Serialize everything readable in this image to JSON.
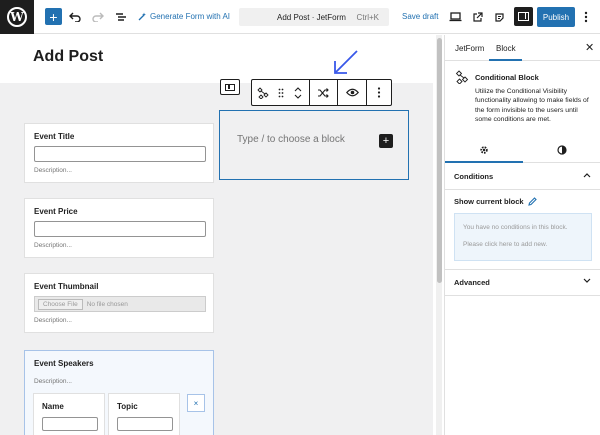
{
  "topbar": {
    "generate_ai_label": "Generate Form with AI",
    "doc_title": "Add Post · JetForm",
    "shortcut": "Ctrl+K",
    "save_draft": "Save draft",
    "publish": "Publish"
  },
  "editor": {
    "page_title": "Add Post",
    "fields": [
      {
        "label": "Event Title",
        "description": "Description..."
      },
      {
        "label": "Event Price",
        "description": "Description..."
      },
      {
        "label": "Event Thumbnail",
        "description": "Description...",
        "file_button": "Choose File",
        "file_status": "No file chosen"
      }
    ],
    "repeater": {
      "label": "Event Speakers",
      "description": "Description...",
      "columns": [
        {
          "label": "Name"
        },
        {
          "label": "Topic"
        }
      ],
      "remove_glyph": "×"
    },
    "empty_block": {
      "placeholder": "Type / to choose a block",
      "add_glyph": "+"
    }
  },
  "sidebar": {
    "tabs": [
      "JetForm",
      "Block"
    ],
    "active_tab": "Block",
    "close_glyph": "✕",
    "block_card": {
      "name": "Conditional Block",
      "description": "Utilize the Conditional Visibility functionality allowing to make fields of the form invisible to the users until some conditions are met."
    },
    "panels": {
      "conditions": {
        "title": "Conditions",
        "show_current": "Show current block",
        "empty_line1": "You have no conditions in this block.",
        "empty_line2": "Please click here to add new."
      },
      "advanced": {
        "title": "Advanced"
      }
    }
  },
  "colors": {
    "accent": "#2271b1",
    "canvas": "#f0f0f1",
    "dark": "#1e1e1e"
  }
}
